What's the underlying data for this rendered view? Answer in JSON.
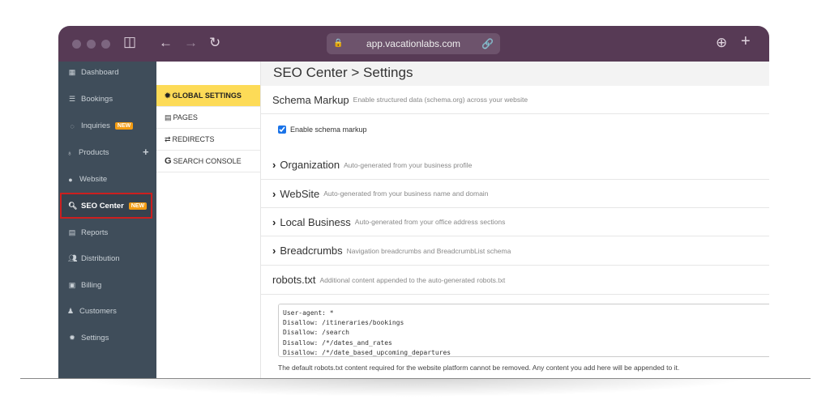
{
  "browser": {
    "url": "app.vacationlabs.com"
  },
  "sidebar": {
    "items": [
      {
        "label": "Dashboard",
        "icon": "calendar-icon"
      },
      {
        "label": "Bookings",
        "icon": "list-icon"
      },
      {
        "label": "Inquiries",
        "icon": "chat-icon",
        "badge": "NEW"
      },
      {
        "label": "Products",
        "icon": "lightbulb-icon",
        "action": "+"
      },
      {
        "label": "Website",
        "icon": "globe-icon"
      },
      {
        "label": "SEO Center",
        "icon": "search-icon",
        "badge": "NEW",
        "active": true
      },
      {
        "label": "Reports",
        "icon": "report-icon"
      },
      {
        "label": "Distribution",
        "icon": "users-icon"
      },
      {
        "label": "Billing",
        "icon": "money-icon"
      },
      {
        "label": "Customers",
        "icon": "user-icon"
      },
      {
        "label": "Settings",
        "icon": "gear-icon"
      }
    ]
  },
  "subnav": {
    "items": [
      {
        "label": "GLOBAL SETTINGS",
        "icon": "gear-icon",
        "active": true
      },
      {
        "label": "PAGES",
        "icon": "file-icon"
      },
      {
        "label": "REDIRECTS",
        "icon": "exchange-icon"
      },
      {
        "label": "SEARCH CONSOLE",
        "icon": "google-icon"
      }
    ]
  },
  "main": {
    "title": "SEO Center > Settings",
    "schema": {
      "title": "Schema Markup",
      "desc": "Enable structured data (schema.org) across your website",
      "checkbox_label": "Enable schema markup",
      "checked": true
    },
    "sections": [
      {
        "title": "Organization",
        "desc": "Auto-generated from your business profile"
      },
      {
        "title": "WebSite",
        "desc": "Auto-generated from your business name and domain"
      },
      {
        "title": "Local Business",
        "desc": "Auto-generated from your office address sections"
      },
      {
        "title": "Breadcrumbs",
        "desc": "Navigation breadcrumbs and BreadcrumbList schema"
      }
    ],
    "robots": {
      "title": "robots.txt",
      "desc": "Additional content appended to the auto-generated robots.txt",
      "content": "User-agent: *\nDisallow: /itineraries/bookings\nDisallow: /search\nDisallow: /*/dates_and_rates\nDisallow: /*/date_based_upcoming_departures",
      "note": "The default robots.txt content required for the website platform cannot be removed. Any content you add here will be appended to it."
    }
  },
  "colors": {
    "titlebar": "#573a55",
    "sidebar": "#3f4d5a",
    "active_tab": "#fddb57",
    "badge": "#f39c12",
    "highlight": "#cc1f1f"
  }
}
